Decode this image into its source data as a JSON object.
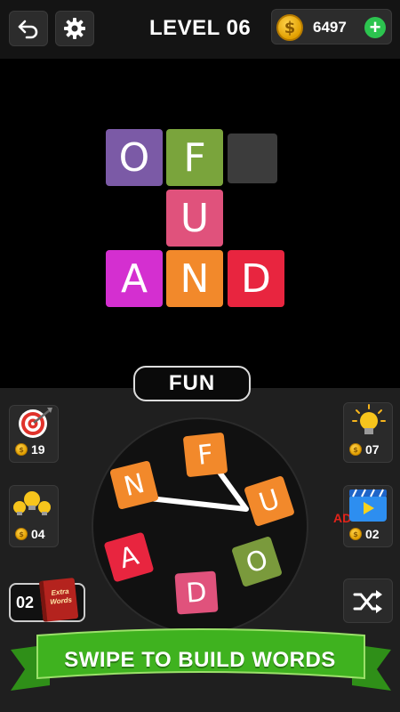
{
  "header": {
    "level_label": "LEVEL 06",
    "coins": "6497",
    "coin_symbol": "$",
    "plus_label": "+"
  },
  "board": {
    "tiles": [
      {
        "letter": "O",
        "color": "#7b5aa6"
      },
      {
        "letter": "F",
        "color": "#7aa43c"
      },
      {
        "letter": "",
        "color": "#3c3c3c"
      },
      {
        "letter": "U",
        "color": "#e0527c"
      },
      {
        "letter": "A",
        "color": "#d42fd0"
      },
      {
        "letter": "N",
        "color": "#f2892b"
      },
      {
        "letter": "D",
        "color": "#e8253f"
      }
    ]
  },
  "current_word": "FUN",
  "powerups": {
    "target": {
      "icon": "target-icon",
      "cost": "19"
    },
    "bulbs": {
      "icon": "multi-bulb-icon",
      "cost": "04"
    },
    "hint": {
      "icon": "lightbulb-icon",
      "cost": "07"
    },
    "video": {
      "icon": "video-ad-icon",
      "cost": "02",
      "ad_label": "AD"
    },
    "extra_words": {
      "count": "02",
      "book_label_1": "Extra",
      "book_label_2": "Words"
    },
    "shuffle": {
      "icon": "shuffle-icon"
    }
  },
  "wheel": {
    "letters": [
      {
        "letter": "F",
        "color": "#f2892b"
      },
      {
        "letter": "N",
        "color": "#f2892b"
      },
      {
        "letter": "U",
        "color": "#f2892b"
      },
      {
        "letter": "A",
        "color": "#e8253f"
      },
      {
        "letter": "O",
        "color": "#7a9a3c"
      },
      {
        "letter": "D",
        "color": "#e0527c"
      }
    ]
  },
  "banner": {
    "text": "SWIPE TO BUILD WORDS",
    "color": "#3fb21f"
  }
}
